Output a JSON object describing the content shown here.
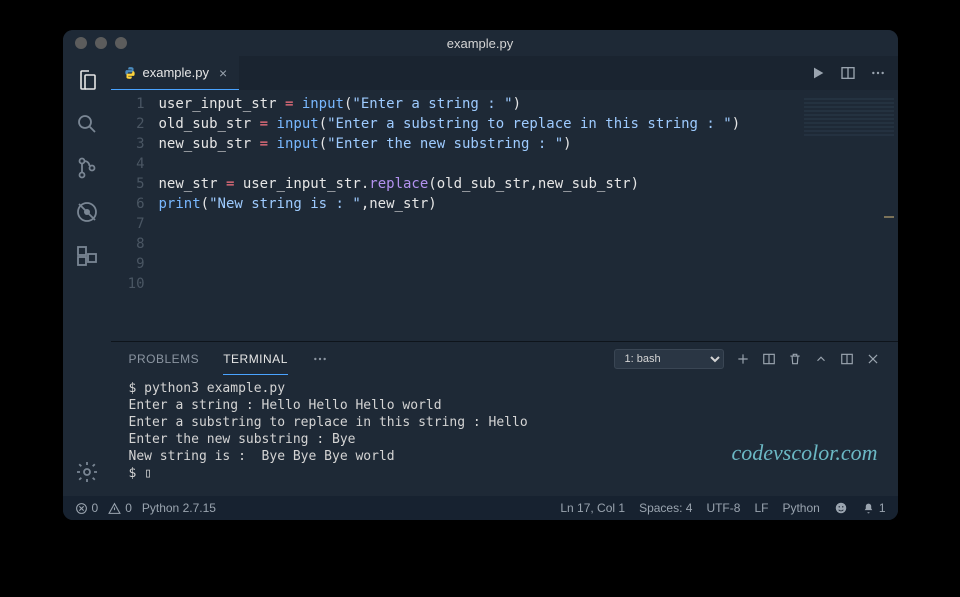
{
  "window": {
    "title": "example.py"
  },
  "tab": {
    "filename": "example.py"
  },
  "code": {
    "lines": [
      {
        "n": 1,
        "html": "<span class=tok-var>user_input_str</span> <span class=tok-op>=</span> <span class=tok-fn>input</span><span class=tok-punc>(</span><span class=tok-str>\"Enter a string : \"</span><span class=tok-punc>)</span>"
      },
      {
        "n": 2,
        "html": "<span class=tok-var>old_sub_str</span> <span class=tok-op>=</span> <span class=tok-fn>input</span><span class=tok-punc>(</span><span class=tok-str>\"Enter a substring to replace in this string : \"</span><span class=tok-punc>)</span>"
      },
      {
        "n": 3,
        "html": "<span class=tok-var>new_sub_str</span> <span class=tok-op>=</span> <span class=tok-fn>input</span><span class=tok-punc>(</span><span class=tok-str>\"Enter the new substring : \"</span><span class=tok-punc>)</span>"
      },
      {
        "n": 4,
        "html": ""
      },
      {
        "n": 5,
        "html": "<span class=tok-var>new_str</span> <span class=tok-op>=</span> <span class=tok-var>user_input_str</span><span class=tok-punc>.</span><span class=tok-call>replace</span><span class=tok-punc>(</span><span class=tok-var>old_sub_str</span><span class=tok-punc>,</span><span class=tok-var>new_sub_str</span><span class=tok-punc>)</span>"
      },
      {
        "n": 6,
        "html": "<span class=tok-fn>print</span><span class=tok-punc>(</span><span class=tok-str>\"New string is : \"</span><span class=tok-punc>,</span><span class=tok-var>new_str</span><span class=tok-punc>)</span>"
      },
      {
        "n": 7,
        "html": ""
      },
      {
        "n": 8,
        "html": ""
      },
      {
        "n": 9,
        "html": ""
      },
      {
        "n": 10,
        "html": ""
      }
    ]
  },
  "panel": {
    "tabs": {
      "problems": "PROBLEMS",
      "terminal": "TERMINAL"
    },
    "shell_label": "1: bash",
    "terminal_output": "$ python3 example.py\nEnter a string : Hello Hello Hello world\nEnter a substring to replace in this string : Hello\nEnter the new substring : Bye\nNew string is :  Bye Bye Bye world\n$ ▯"
  },
  "statusbar": {
    "errors": "0",
    "warnings": "0",
    "interpreter": "Python 2.7.15",
    "position": "Ln 17, Col 1",
    "spaces": "Spaces: 4",
    "encoding": "UTF-8",
    "eol": "LF",
    "language": "Python",
    "notifications": "1"
  },
  "watermark": "codevscolor.com"
}
